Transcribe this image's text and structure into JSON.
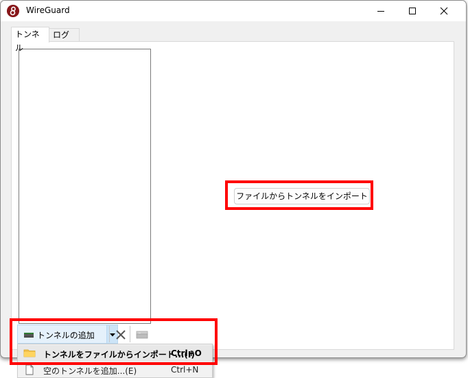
{
  "window": {
    "title": "WireGuard",
    "icons": {
      "app": "wireguard-logo-icon",
      "minimize": "minimize-icon",
      "maximize": "maximize-icon",
      "close": "close-icon"
    }
  },
  "tabs": [
    {
      "label": "トンネル",
      "selected": true
    },
    {
      "label": "ログ",
      "selected": false
    }
  ],
  "main": {
    "import_button_label": "ファイルからトンネルをインポート"
  },
  "toolbar": {
    "add_tunnel_label": "トンネルの追加",
    "icons": {
      "add_tunnel": "add-tunnel-icon",
      "dropdown": "chevron-down-icon",
      "delete": "delete-icon",
      "export": "export-icon"
    }
  },
  "menu": {
    "items": [
      {
        "label": "トンネルをファイルからインポート...(I)",
        "shortcut": "Ctrl+O",
        "icon": "folder-icon",
        "highlighted": true
      },
      {
        "label": "空のトンネルを追加...(E)",
        "shortcut": "Ctrl+N",
        "icon": "document-icon",
        "highlighted": false
      }
    ]
  },
  "colors": {
    "highlight_border": "#ff0000",
    "app_icon": "#88171a",
    "toolbar_button_bg": "#e5f1fb",
    "menu_bg": "#f2f2f2"
  }
}
